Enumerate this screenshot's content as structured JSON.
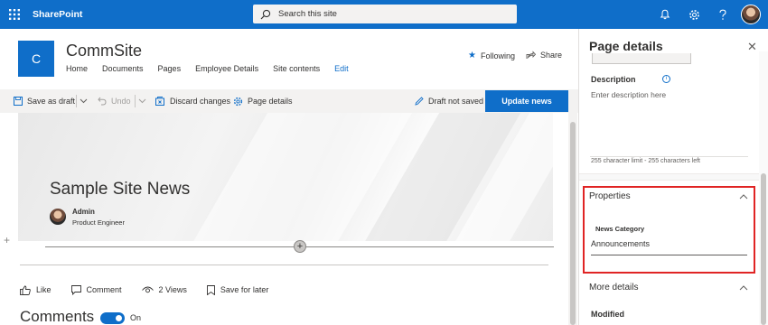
{
  "suitebar": {
    "brand": "SharePoint",
    "search_placeholder": "Search this site"
  },
  "site": {
    "logo_letter": "C",
    "title": "CommSite",
    "nav": [
      "Home",
      "Documents",
      "Pages",
      "Employee Details",
      "Site contents"
    ],
    "edit_link": "Edit",
    "following_label": "Following",
    "share_label": "Share"
  },
  "commandbar": {
    "save_as_draft": "Save as draft",
    "undo": "Undo",
    "discard_changes": "Discard changes",
    "page_details": "Page details",
    "draft_status": "Draft not saved",
    "update_news": "Update news"
  },
  "article": {
    "title": "Sample Site News",
    "author_name": "Admin",
    "author_role": "Product Engineer",
    "like_label": "Like",
    "comment_label": "Comment",
    "views_label": "2 Views",
    "save_for_later_label": "Save for later",
    "comments_title": "Comments",
    "comments_toggle_state": "On"
  },
  "panel": {
    "title": "Page details",
    "description_label": "Description",
    "description_placeholder": "Enter description here",
    "char_limit": "255 character limit - 255 characters left",
    "properties_header": "Properties",
    "news_category_label": "News Category",
    "news_category_value": "Announcements",
    "more_details_header": "More details",
    "modified_label": "Modified"
  },
  "colors": {
    "brand_blue": "#0f6ec9",
    "highlight_red": "#e02424"
  }
}
